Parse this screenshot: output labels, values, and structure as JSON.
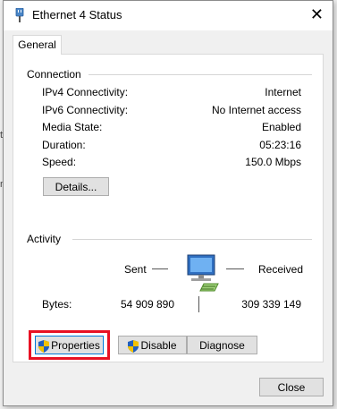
{
  "background": {
    "fragments": [
      "te",
      "n"
    ]
  },
  "window": {
    "title": "Ethernet 4 Status",
    "icon": "ethernet-adapter-icon",
    "close_glyph": "✕"
  },
  "tabs": [
    {
      "label": "General",
      "selected": true
    }
  ],
  "connection": {
    "group_label": "Connection",
    "rows": [
      {
        "label": "IPv4 Connectivity:",
        "value": "Internet"
      },
      {
        "label": "IPv6 Connectivity:",
        "value": "No Internet access"
      },
      {
        "label": "Media State:",
        "value": "Enabled"
      },
      {
        "label": "Duration:",
        "value": "05:23:16"
      },
      {
        "label": "Speed:",
        "value": "150.0 Mbps"
      }
    ],
    "details_button": "Details..."
  },
  "activity": {
    "group_label": "Activity",
    "sent_label": "Sent",
    "received_label": "Received",
    "bytes_label": "Bytes:",
    "bytes_sent": "54 909 890",
    "bytes_received": "309 339 149",
    "icon": "network-computer-icon"
  },
  "buttons": {
    "properties": "Properties",
    "disable": "Disable",
    "diagnose": "Diagnose",
    "close": "Close"
  },
  "colors": {
    "highlight": "#e81123",
    "focus": "#0078d7",
    "shield_blue": "#1f5fbf",
    "shield_yellow": "#f2c200"
  }
}
